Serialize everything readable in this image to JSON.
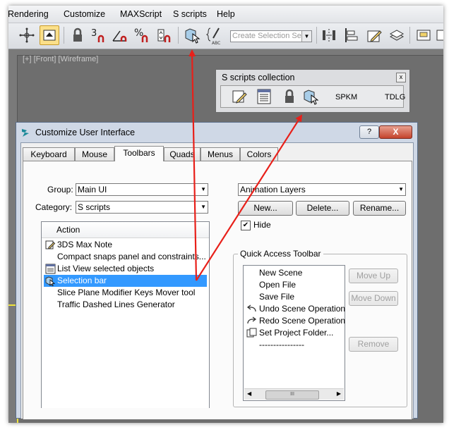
{
  "menubar": {
    "items": [
      "Rendering",
      "Customize",
      "MAXScript",
      "S scripts",
      "Help"
    ]
  },
  "toolbar": {
    "number_label": "3",
    "selection_set_placeholder": "Create Selection Se"
  },
  "viewport": {
    "label": "[+] [Front] [Wireframe]"
  },
  "scripts_panel": {
    "title": "S scripts collection",
    "close_glyph": "x",
    "text_buttons": [
      "SPKM",
      "TDLG"
    ]
  },
  "dialog": {
    "title": "Customize User Interface",
    "help_label": "?",
    "close_label": "X",
    "tabs": [
      "Keyboard",
      "Mouse",
      "Toolbars",
      "Quads",
      "Menus",
      "Colors"
    ],
    "active_tab": "Toolbars",
    "group_label": "Group:",
    "group_value": "Main UI",
    "category_label": "Category:",
    "category_value": "S scripts",
    "action_header": "Action",
    "actions": [
      "3DS Max Note",
      "Compact snaps panel and constraints...",
      "List View selected objects",
      "Selection bar",
      "Slice Plane Modifier Keys Mover tool",
      "Traffic Dashed Lines Generator"
    ],
    "selected_action": "Selection bar",
    "toolbar_dropdown_value": "Animation Layers",
    "new_button": "New...",
    "delete_button": "Delete...",
    "rename_button": "Rename...",
    "hide_label": "Hide",
    "hide_checked": true,
    "quick_access": {
      "title": "Quick Access Toolbar",
      "items": [
        "New Scene",
        "Open File",
        "Save File",
        "Undo Scene Operation",
        "Redo Scene Operation",
        "Set Project Folder...",
        "----------------"
      ],
      "move_up": "Move Up",
      "move_down": "Move Down",
      "remove": "Remove",
      "scroll_thumb": "III"
    }
  },
  "colors": {
    "selection_highlight": "#3399ff",
    "annotation_arrow": "#e8201a",
    "close_button": "#c4432c"
  }
}
